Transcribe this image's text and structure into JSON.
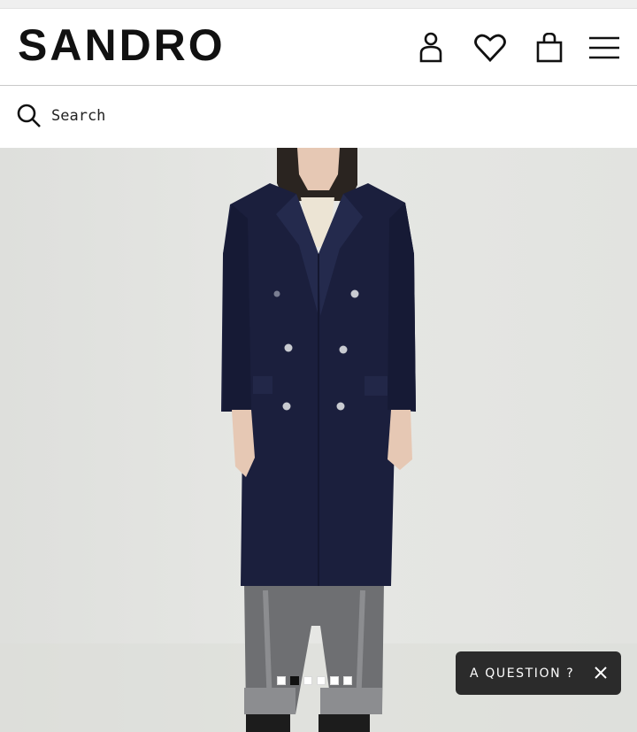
{
  "brand": {
    "name": "SANDRO"
  },
  "header": {
    "icons": [
      "account-icon",
      "wishlist-heart-icon",
      "shopping-bag-icon",
      "menu-icon"
    ]
  },
  "search": {
    "placeholder": "Search",
    "value": ""
  },
  "gallery": {
    "image_count": 6,
    "active_index": 1
  },
  "help_widget": {
    "label": "A QUESTION ?",
    "close_icon": "close-icon"
  },
  "colors": {
    "coat": "#1b1f3d",
    "widget_bg": "#2b2b2b",
    "text": "#111111"
  }
}
